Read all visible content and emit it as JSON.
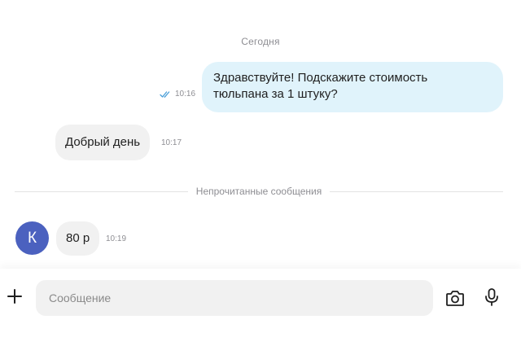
{
  "chat": {
    "date_separator": "Сегодня",
    "messages": [
      {
        "direction": "outgoing",
        "line1": "Здравствуйте! Подскажите стоимость",
        "line2": "тюльпана за 1 штуку?",
        "time": "10:16",
        "status_icon": "double-check-icon"
      },
      {
        "direction": "incoming",
        "text": "Добрый день",
        "time": "10:17"
      },
      {
        "direction": "incoming",
        "text": "80 р",
        "time": "10:19",
        "avatar_letter": "К"
      }
    ],
    "unread_separator": "Непрочитанные сообщения"
  },
  "composer": {
    "placeholder": "Сообщение",
    "value": "",
    "icons": [
      "plus-icon",
      "camera-icon",
      "microphone-icon"
    ]
  },
  "colors": {
    "outgoing_bubble": "#e0f3fb",
    "incoming_bubble": "#f1f1f1",
    "avatar": "#4b61bf",
    "read_ticks": "#4a9fd8",
    "meta_text": "#8e8e93"
  }
}
